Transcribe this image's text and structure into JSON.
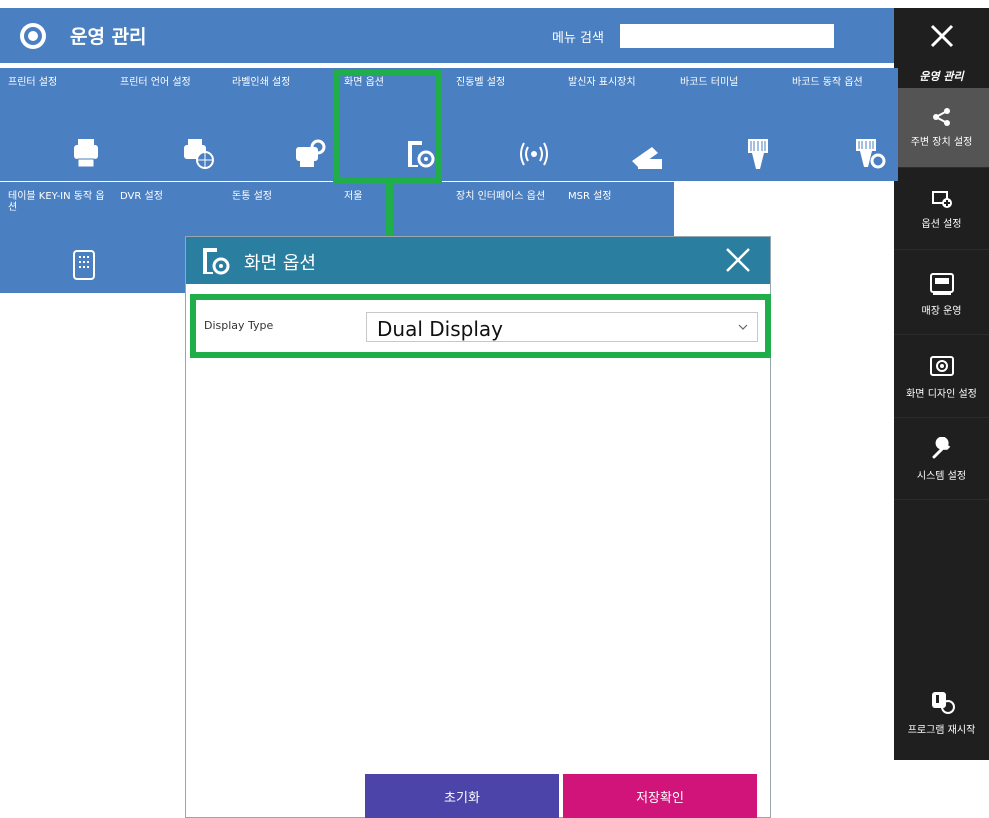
{
  "header": {
    "title": "운영 관리",
    "search_label": "메뉴 검색",
    "search_value": ""
  },
  "sidebar": {
    "title": "운영 관리",
    "items": [
      {
        "label": "주변 장치 설정",
        "icon": "share-icon"
      },
      {
        "label": "옵션 설정",
        "icon": "screen-plus-icon"
      },
      {
        "label": "매장 운영",
        "icon": "register-icon"
      },
      {
        "label": "화면 디자인 설정",
        "icon": "screen-gear-icon"
      },
      {
        "label": "시스템 설정",
        "icon": "wrench-icon"
      },
      {
        "label": "프로그램 재시작",
        "icon": "restart-icon"
      }
    ]
  },
  "tiles": [
    {
      "label": "프린터 설정",
      "icon": "printer-icon"
    },
    {
      "label": "프린터 언어 설정",
      "icon": "printer-globe-icon"
    },
    {
      "label": "라벨인쇄 설정",
      "icon": "label-printer-icon"
    },
    {
      "label": "화면 옵션",
      "icon": "screen-option-icon"
    },
    {
      "label": "진동벨 설정",
      "icon": "vibration-bell-icon"
    },
    {
      "label": "발신자 표시장치",
      "icon": "caller-id-icon"
    },
    {
      "label": "바코드 터미널",
      "icon": "barcode-terminal-icon"
    },
    {
      "label": "바코드 동작 옵션",
      "icon": "barcode-option-icon"
    },
    {
      "label": "테이블 KEY-IN 동작 옵션",
      "icon": "keypad-icon"
    },
    {
      "label": "DVR 설정",
      "icon": "dvr-icon"
    },
    {
      "label": "돈통 설정",
      "icon": "cash-drawer-icon"
    },
    {
      "label": "저울",
      "icon": "scale-icon"
    },
    {
      "label": "장치 인터페이스 옵션",
      "icon": "interface-icon"
    },
    {
      "label": "MSR 설정",
      "icon": "msr-icon"
    }
  ],
  "dialog": {
    "title": "화면 옵션",
    "field_label": "Display Type",
    "field_value": "Dual Display",
    "reset_label": "초기화",
    "save_label": "저장확인"
  },
  "colors": {
    "tile": "#4a7fc1",
    "sidebar": "#1f1f1f",
    "dialog_header": "#2a7fa0",
    "highlight": "#1fae4a",
    "reset": "#4c44a8",
    "save": "#d1147a"
  }
}
